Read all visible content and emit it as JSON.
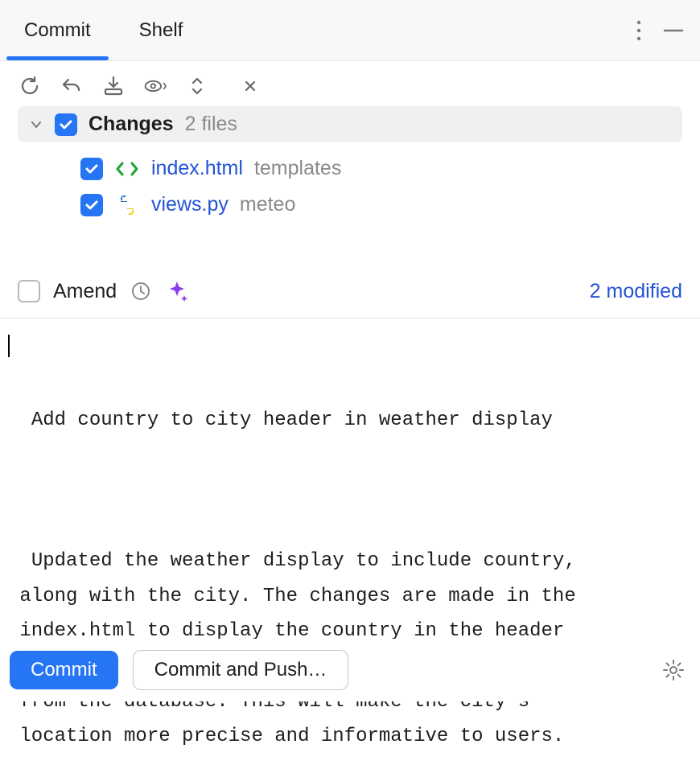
{
  "tabs": {
    "commit": "Commit",
    "shelf": "Shelf"
  },
  "changes": {
    "label": "Changes",
    "count_text": "2 files",
    "files": [
      {
        "name": "index.html",
        "dir": "templates"
      },
      {
        "name": "views.py",
        "dir": "meteo"
      }
    ]
  },
  "amend": {
    "label": "Amend",
    "modified_text": "2 modified"
  },
  "commit_message": {
    "title": "Add country to city header in weather display",
    "body": "Updated the weather display to include country,\n along with the city. The changes are made in the\n index.html to display the country in the header\n and views.py to retrieve the country information\n from the database. This will make the city's\n location more precise and informative to users."
  },
  "buttons": {
    "commit": "Commit",
    "commit_push": "Commit and Push…"
  }
}
